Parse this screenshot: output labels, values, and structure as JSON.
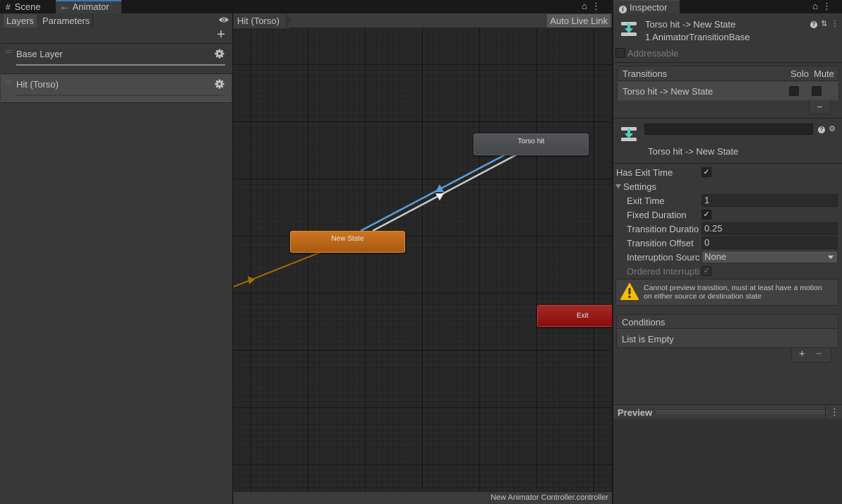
{
  "left_dock": {
    "tabs": [
      {
        "label": "Scene",
        "icon": "grid-hash-icon",
        "active": false
      },
      {
        "label": "Animator",
        "icon": "animator-fork-icon",
        "active": true
      }
    ],
    "window_controls": {
      "lock": "lock-icon",
      "more": "kebab-menu-icon"
    }
  },
  "layers_panel": {
    "subtabs": [
      {
        "label": "Layers",
        "active": true
      },
      {
        "label": "Parameters",
        "active": false
      }
    ],
    "add_label": "+",
    "layers": [
      {
        "name": "Base Layer",
        "selected": false
      },
      {
        "name": "Hit (Torso)",
        "selected": true
      }
    ]
  },
  "graph": {
    "breadcrumb": "Hit (Torso)",
    "auto_live_link": "Auto Live Link",
    "nodes": [
      {
        "id": "torso-hit",
        "label": "Torso hit",
        "color": "#4b4d50"
      },
      {
        "id": "new-state",
        "label": "New State",
        "color": "#c06a1c",
        "default": true
      },
      {
        "id": "exit",
        "label": "Exit",
        "color": "#980f0f"
      }
    ],
    "transitions": [
      {
        "from": "Torso hit",
        "to": "New State",
        "selected": true,
        "color": "#5b9ee0"
      },
      {
        "from": "New State",
        "to": "Torso hit",
        "selected": false,
        "color": "#c8c8c8"
      },
      {
        "from": "Entry",
        "to": "New State",
        "selected": false,
        "color": "#a56c00"
      }
    ],
    "status_text": "New Animator Controller.controller"
  },
  "inspector": {
    "tab_label": "Inspector",
    "header": {
      "title": "Torso hit -> New State",
      "subtitle": "1 AnimatorTransitionBase"
    },
    "addressable": {
      "label": "Addressable",
      "checked": false
    },
    "transitions_list": {
      "header": "Transitions",
      "solo_label": "Solo",
      "mute_label": "Mute",
      "rows": [
        {
          "name": "Torso hit -> New State",
          "solo": false,
          "mute": false
        }
      ],
      "remove_label": "−"
    },
    "transition": {
      "name_value": "",
      "title": "Torso hit -> New State",
      "has_exit_time": {
        "label": "Has Exit Time",
        "checked": true
      },
      "settings_label": "Settings",
      "exit_time": {
        "label": "Exit Time",
        "value": "1"
      },
      "fixed_duration": {
        "label": "Fixed Duration",
        "checked": true
      },
      "transition_duration": {
        "label": "Transition Duratio",
        "value": "0.25"
      },
      "transition_offset": {
        "label": "Transition Offset",
        "value": "0"
      },
      "interruption_source": {
        "label": "Interruption Sourc",
        "value": "None"
      },
      "ordered_interruption": {
        "label": "Ordered Interrupti",
        "checked": true,
        "disabled": true
      }
    },
    "warning": {
      "line1": "Cannot preview transition, must at least have a motion",
      "line2": "on either source or destination state"
    },
    "conditions": {
      "header": "Conditions",
      "empty_text": "List is Empty",
      "add_label": "+",
      "remove_label": "−"
    },
    "preview": {
      "label": "Preview"
    }
  }
}
